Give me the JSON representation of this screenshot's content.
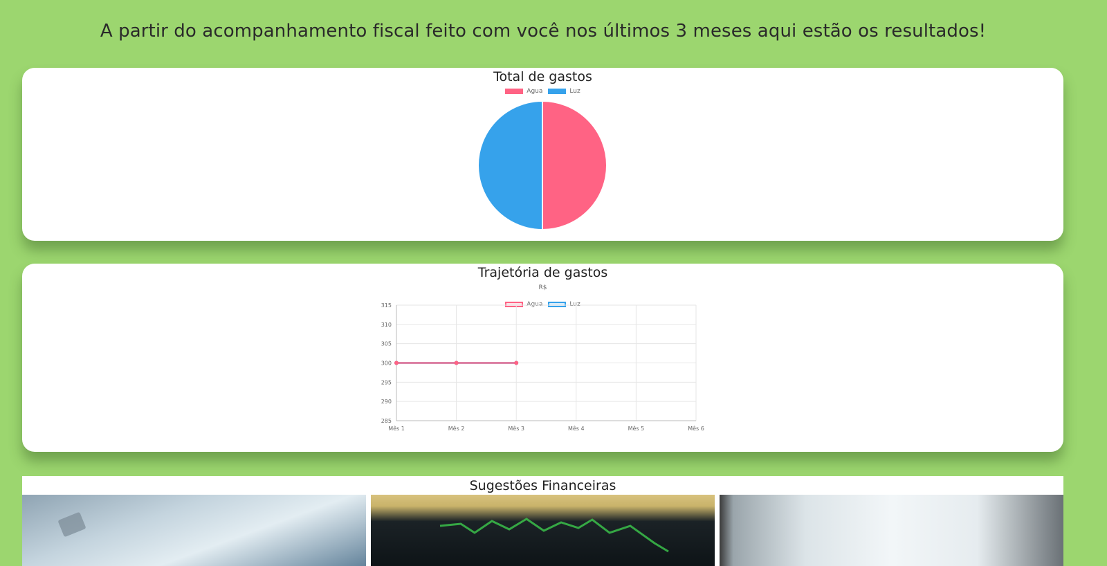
{
  "headline": "A partir do acompanhamento fiscal feito com você nos últimos 3 meses aqui estão os resultados!",
  "colors": {
    "page_bg": "#9cd66f",
    "agua": "#ff6384",
    "luz": "#36a2eb"
  },
  "pie_card": {
    "title": "Total de gastos",
    "legend": [
      "Agua",
      "Luz"
    ]
  },
  "line_card": {
    "title": "Trajetória de gastos",
    "subtitle": "R$",
    "legend": [
      "Agua",
      "Luz"
    ]
  },
  "suggestions": {
    "title": "Sugestões Financeiras",
    "images": [
      {
        "name": "credit-card-photo"
      },
      {
        "name": "stock-chart-photo"
      },
      {
        "name": "office-window-photo"
      }
    ]
  },
  "chart_data": [
    {
      "type": "pie",
      "title": "Total de gastos",
      "categories": [
        "Agua",
        "Luz"
      ],
      "values": [
        50,
        50
      ],
      "legend": "top"
    },
    {
      "type": "line",
      "title": "Trajetória de gastos",
      "ylabel": "R$",
      "x": [
        "Mês 1",
        "Mês 2",
        "Mês 3",
        "Mês 4",
        "Mês 5",
        "Mês 6"
      ],
      "yticks": [
        315,
        310,
        305,
        300,
        295,
        290,
        285
      ],
      "ylim": [
        285,
        315
      ],
      "series": [
        {
          "name": "Agua",
          "values": [
            300,
            300,
            300
          ]
        },
        {
          "name": "Luz",
          "values": [
            300,
            300,
            300
          ]
        }
      ],
      "grid": true,
      "legend": "top"
    }
  ]
}
